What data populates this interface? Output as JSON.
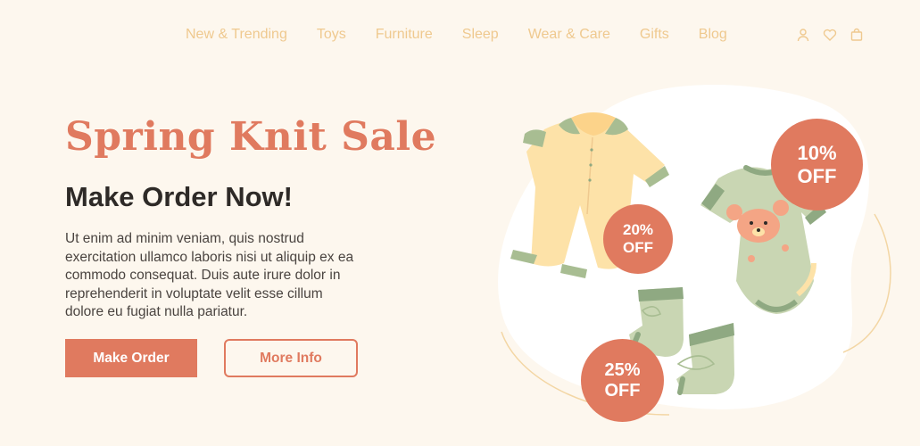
{
  "nav": {
    "items": [
      "New & Trending",
      "Toys",
      "Furniture",
      "Sleep",
      "Wear & Care",
      "Gifts",
      "Blog"
    ],
    "icons": [
      "user-icon",
      "heart-icon",
      "bag-icon"
    ]
  },
  "hero": {
    "title": "Spring Knit Sale",
    "subtitle": "Make Order Now!",
    "body": "Ut enim ad minim veniam, quis nostrud exercitation ullamco laboris nisi ut aliquip ex ea commodo consequat. Duis aute irure dolor in reprehenderit in voluptate velit esse cillum dolore eu fugiat nulla pariatur.",
    "primary_button": "Make Order",
    "secondary_button": "More Info"
  },
  "badges": {
    "b1": {
      "pct": "10%",
      "off": "OFF"
    },
    "b2": {
      "pct": "20%",
      "off": "OFF"
    },
    "b3": {
      "pct": "25%",
      "off": "OFF"
    }
  },
  "colors": {
    "background": "#fdf7ee",
    "accent": "#e07a5f",
    "nav": "#efc98f",
    "garment_yellow": "#fde2a8",
    "garment_green": "#c9d6b3",
    "trim_green": "#8fa982"
  }
}
